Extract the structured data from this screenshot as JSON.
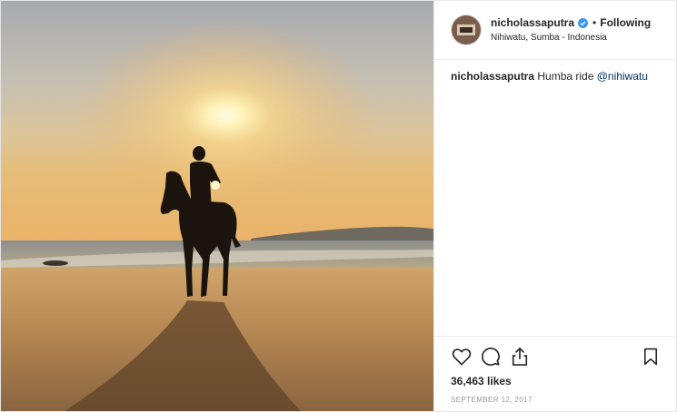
{
  "post": {
    "username": "nicholassaputra",
    "follow_label": "Following",
    "location": "Nihiwatu, Sumba - Indonesia",
    "caption_user": "nicholassaputra",
    "caption_text": "Humba ride ",
    "caption_mention": "@nihiwatu",
    "likes": "36,463 likes",
    "date": "SEPTEMBER 12, 2017",
    "dot": "•"
  },
  "icons": {
    "like": "heart-icon",
    "comment": "comment-icon",
    "share": "share-icon",
    "save": "bookmark-icon",
    "verified": "verified-badge-icon"
  },
  "colors": {
    "verified": "#3897f0",
    "mention": "#003569",
    "text": "#262626",
    "muted": "#999999"
  }
}
